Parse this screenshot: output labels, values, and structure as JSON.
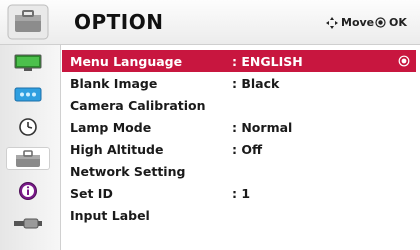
{
  "header": {
    "title": "OPTION",
    "move_label": "Move",
    "ok_label": "OK"
  },
  "sidebar": {
    "items": [
      {
        "icon": "picture-icon"
      },
      {
        "icon": "audio-icon"
      },
      {
        "icon": "clock-icon"
      },
      {
        "icon": "option-icon",
        "active": true
      },
      {
        "icon": "info-icon"
      },
      {
        "icon": "input-icon"
      }
    ]
  },
  "menu": {
    "items": [
      {
        "label": "Menu Language",
        "value": ": ENGLISH",
        "selected": true
      },
      {
        "label": "Blank Image",
        "value": ": Black"
      },
      {
        "label": "Camera Calibration",
        "value": ""
      },
      {
        "label": "Lamp Mode",
        "value": ": Normal"
      },
      {
        "label": "High Altitude",
        "value": ": Off"
      },
      {
        "label": "Network Setting",
        "value": ""
      },
      {
        "label": "Set ID",
        "value": ": 1"
      },
      {
        "label": "Input Label",
        "value": ""
      }
    ]
  },
  "colors": {
    "selected_row": "#c8163f",
    "text": "#1a1a1a"
  }
}
